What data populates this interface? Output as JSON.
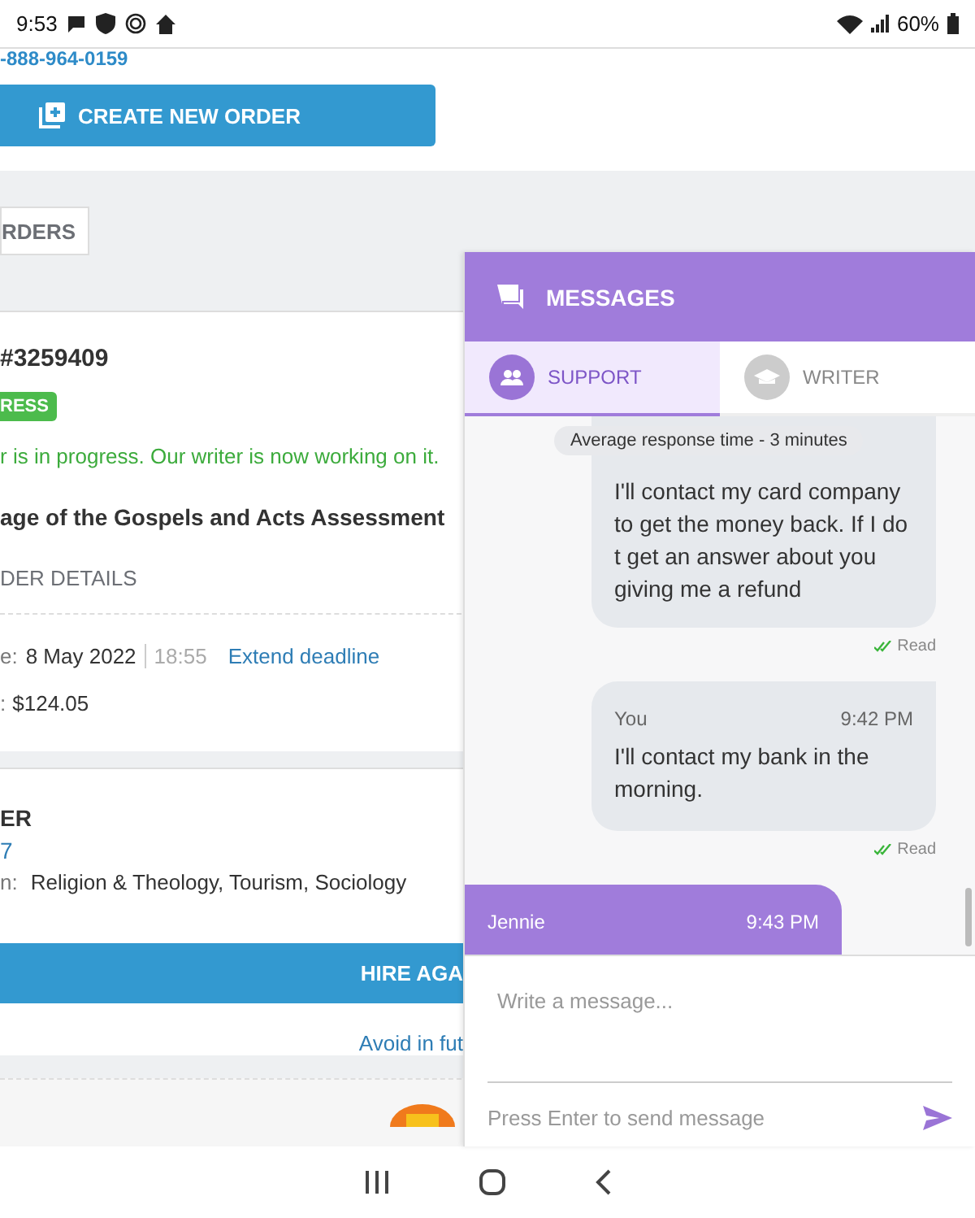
{
  "status_bar": {
    "time": "9:53",
    "battery": "60%"
  },
  "page": {
    "phone": "-888-964-0159",
    "create_button": "CREATE NEW ORDER",
    "orders_tab": "RDERS",
    "order": {
      "number": "#3259409",
      "status": "RESS",
      "status_message": "r is in progress. Our writer is now working on it.",
      "title": "age of the Gospels and Acts Assessment",
      "details_heading": "DER DETAILS",
      "deadline_label": "e:",
      "deadline_date": "8 May 2022",
      "deadline_time": "18:55",
      "extend_link": "Extend deadline",
      "price_label": ":",
      "price": "$124.05"
    },
    "writer": {
      "heading": "ER",
      "id": "7",
      "spec_label": "n:",
      "specialization": "Religion & Theology, Tourism, Sociology",
      "hire_button": "HIRE AGA",
      "avoid_link": "Avoid in fut"
    }
  },
  "messages": {
    "title": "MESSAGES",
    "tabs": [
      {
        "label": "SUPPORT",
        "selected": true
      },
      {
        "label": "WRITER",
        "selected": false
      }
    ],
    "notice": "Average response time - 3 minutes",
    "items": [
      {
        "kind": "outgoing",
        "text": "I'll contact my card company to get the money back. If I do t get an answer about you giving me a refund",
        "status": "Read"
      },
      {
        "kind": "outgoing",
        "author": "You",
        "time": "9:42 PM",
        "text": "I'll contact my bank in the morning.",
        "status": "Read"
      },
      {
        "kind": "incoming",
        "author": "Jennie",
        "time": "9:43 PM"
      }
    ],
    "input": {
      "placeholder": "Write a message...",
      "hint": "Press Enter to send message"
    }
  }
}
